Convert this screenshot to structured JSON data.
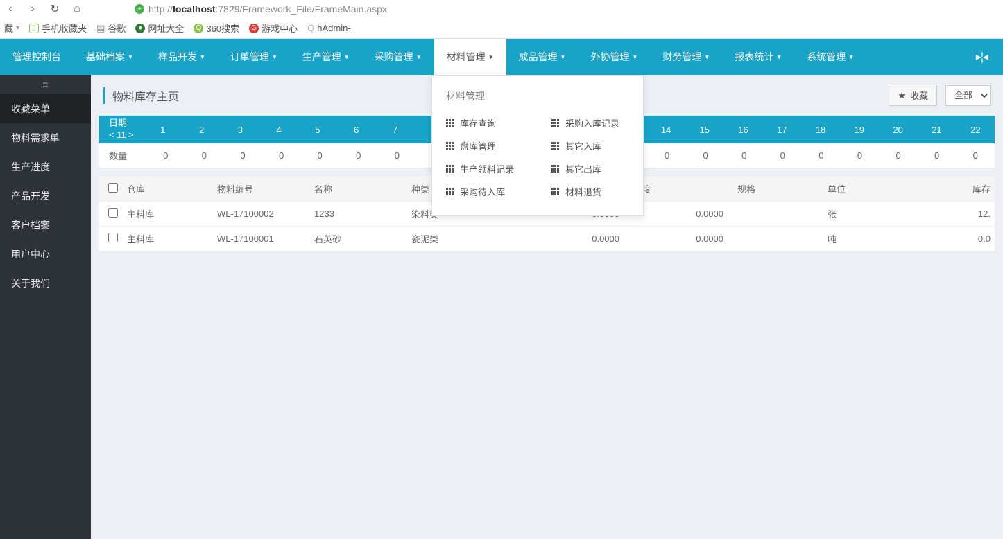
{
  "browser": {
    "url_prefix": "http://",
    "url_host": "localhost",
    "url_rest": ":7829/Framework_File/FrameMain.aspx"
  },
  "bookmarks": {
    "fav": "藏",
    "items": [
      "手机收藏夹",
      "谷歌",
      "网址大全",
      "360搜索",
      "游戏中心",
      "hAdmin-"
    ]
  },
  "topnav": {
    "items": [
      "管理控制台",
      "基础档案",
      "样品开发",
      "订单管理",
      "生产管理",
      "采购管理",
      "材料管理",
      "成品管理",
      "外协管理",
      "财务管理",
      "报表统计",
      "系统管理"
    ],
    "active_index": 6
  },
  "dropdown": {
    "title": "材料管理",
    "left": [
      "库存查询",
      "盘库管理",
      "生产领料记录",
      "采购待入库"
    ],
    "right": [
      "采购入库记录",
      "其它入库",
      "其它出库",
      "材料退货"
    ]
  },
  "sidebar": {
    "items": [
      "收藏菜单",
      "物料需求单",
      "生产进度",
      "产品开发",
      "客户档案",
      "用户中心",
      "关于我们"
    ],
    "selected_index": 0
  },
  "page": {
    "title": "物料库存主页",
    "fav_btn": "收藏",
    "filter": "全部",
    "date_label_line1": "日期",
    "date_label_line2": "< 11 >",
    "qty_label": "数量",
    "days": [
      "1",
      "2",
      "3",
      "4",
      "5",
      "6",
      "7",
      "",
      "",
      "",
      "",
      "",
      "",
      "14",
      "15",
      "16",
      "17",
      "18",
      "19",
      "20",
      "21",
      "22"
    ],
    "qtys": [
      "0",
      "0",
      "0",
      "0",
      "0",
      "0",
      "0",
      "",
      "",
      "",
      "",
      "",
      "",
      "0",
      "0",
      "0",
      "0",
      "0",
      "0",
      "0",
      "0",
      "0"
    ]
  },
  "table": {
    "headers": {
      "warehouse": "仓库",
      "code": "物料编号",
      "name": "名称",
      "kind": "种类",
      "width": "宽度",
      "spec": "规格",
      "unit": "单位",
      "stock": "库存"
    },
    "rows": [
      {
        "warehouse": "主料库",
        "code": "WL-17100002",
        "name": "1233",
        "kind": "染料类",
        "w1": "0.0000",
        "w2": "0.0000",
        "spec": "",
        "unit": "张",
        "stock": "12."
      },
      {
        "warehouse": "主料库",
        "code": "WL-17100001",
        "name": "石英砂",
        "kind": "瓷泥类",
        "w1": "0.0000",
        "w2": "0.0000",
        "spec": "",
        "unit": "吨",
        "stock": "0.0"
      }
    ]
  }
}
